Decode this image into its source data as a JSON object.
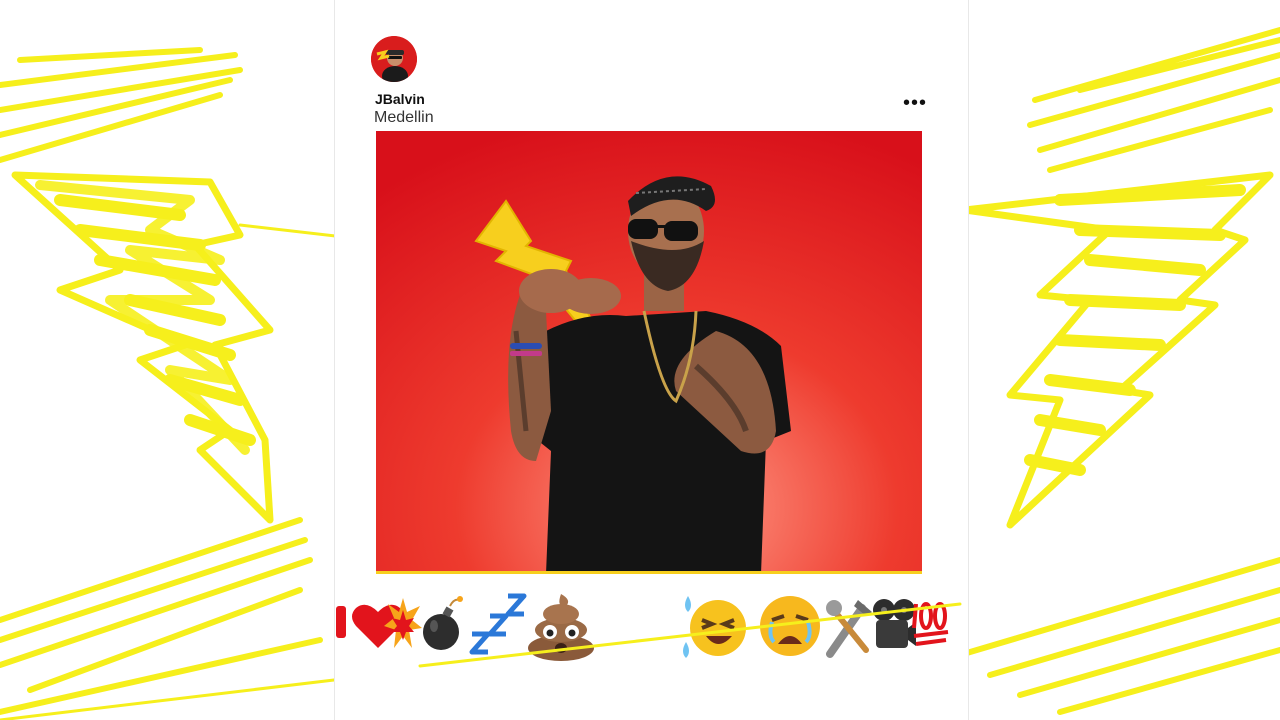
{
  "post": {
    "username": "JBalvin",
    "location": "Medellin",
    "more_label": "•••"
  },
  "photo": {
    "background_color": "#e41e1e",
    "accent_color": "#f7cf1e"
  },
  "reactions": [
    {
      "name": "heart-icon"
    },
    {
      "name": "explosion-icon"
    },
    {
      "name": "bomb-icon"
    },
    {
      "name": "sleeping-zzz-icon"
    },
    {
      "name": "poop-icon"
    },
    {
      "name": "laughing-tears-face-icon"
    },
    {
      "name": "crying-face-icon"
    },
    {
      "name": "tools-icon"
    },
    {
      "name": "film-camera-icon"
    },
    {
      "name": "hundred-points-icon"
    }
  ],
  "colors": {
    "scribble": "#f6ef1c",
    "avatar_bg": "#d91d1d"
  }
}
